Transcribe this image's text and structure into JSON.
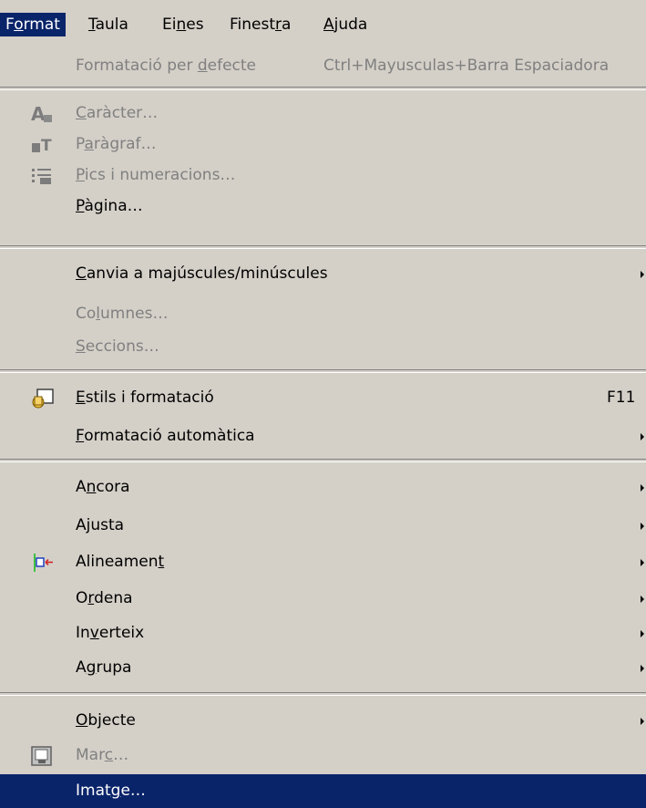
{
  "menubar": {
    "items": [
      {
        "pre": "F",
        "u": "o",
        "post": "rmat"
      },
      {
        "pre": "",
        "u": "T",
        "post": "aula"
      },
      {
        "pre": "Ei",
        "u": "n",
        "post": "es"
      },
      {
        "pre": "Finest",
        "u": "r",
        "post": "a"
      },
      {
        "pre": "",
        "u": "A",
        "post": "juda"
      }
    ]
  },
  "menu": {
    "items": [
      {
        "pre": "Formatació per ",
        "u": "d",
        "post": "efecte",
        "shortcut": "Ctrl+Mayusculas+Barra Espaciadora",
        "disabled": true
      },
      {
        "pre": "",
        "u": "C",
        "post": "aràcter…",
        "icon": "character-icon",
        "disabled": true
      },
      {
        "pre": "P",
        "u": "a",
        "post": "ràgraf…",
        "icon": "paragraph-icon",
        "disabled": true
      },
      {
        "pre": "",
        "u": "P",
        "post": "ics i numeracions…",
        "icon": "bullets-numbering-icon",
        "disabled": true
      },
      {
        "pre": "",
        "u": "P",
        "post": "àgina…"
      },
      {
        "pre": "",
        "u": "C",
        "post": "anvia a majúscules/minúscules",
        "submenu": true
      },
      {
        "pre": "Co",
        "u": "l",
        "post": "umnes…",
        "disabled": true
      },
      {
        "pre": "",
        "u": "S",
        "post": "eccions…",
        "disabled": true
      },
      {
        "pre": "",
        "u": "E",
        "post": "stils i formatació",
        "shortcut": "F11",
        "icon": "styles-formatting-icon"
      },
      {
        "pre": "",
        "u": "F",
        "post": "ormatació automàtica",
        "submenu": true
      },
      {
        "pre": "A",
        "u": "n",
        "post": "cora",
        "submenu": true
      },
      {
        "pre": "A",
        "u": "j",
        "post": "usta",
        "submenu": true
      },
      {
        "pre": "Alineamen",
        "u": "t",
        "post": "",
        "submenu": true,
        "icon": "alignment-icon"
      },
      {
        "pre": "O",
        "u": "r",
        "post": "dena",
        "submenu": true
      },
      {
        "pre": "In",
        "u": "v",
        "post": "erteix",
        "submenu": true
      },
      {
        "pre": "A",
        "u": "g",
        "post": "rupa",
        "submenu": true
      },
      {
        "pre": "",
        "u": "O",
        "post": "bjecte",
        "submenu": true
      },
      {
        "pre": "Mar",
        "u": "c",
        "post": "…",
        "icon": "frame-icon",
        "disabled": true
      },
      {
        "pre": "Imat",
        "u": "g",
        "post": "e…",
        "highlighted": true
      }
    ]
  },
  "colors": {
    "menu_bg": "#d4d0c8",
    "highlight": "#0a246a",
    "disabled": "#808080"
  }
}
